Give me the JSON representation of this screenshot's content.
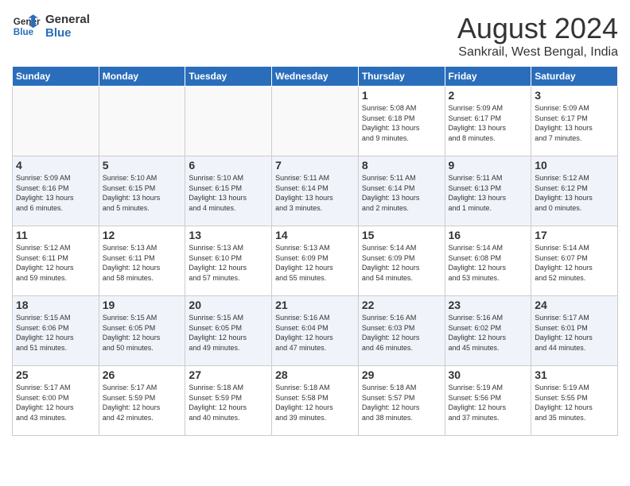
{
  "logo": {
    "line1": "General",
    "line2": "Blue"
  },
  "title": "August 2024",
  "location": "Sankrail, West Bengal, India",
  "days_of_week": [
    "Sunday",
    "Monday",
    "Tuesday",
    "Wednesday",
    "Thursday",
    "Friday",
    "Saturday"
  ],
  "weeks": [
    [
      {
        "day": "",
        "info": ""
      },
      {
        "day": "",
        "info": ""
      },
      {
        "day": "",
        "info": ""
      },
      {
        "day": "",
        "info": ""
      },
      {
        "day": "1",
        "info": "Sunrise: 5:08 AM\nSunset: 6:18 PM\nDaylight: 13 hours\nand 9 minutes."
      },
      {
        "day": "2",
        "info": "Sunrise: 5:09 AM\nSunset: 6:17 PM\nDaylight: 13 hours\nand 8 minutes."
      },
      {
        "day": "3",
        "info": "Sunrise: 5:09 AM\nSunset: 6:17 PM\nDaylight: 13 hours\nand 7 minutes."
      }
    ],
    [
      {
        "day": "4",
        "info": "Sunrise: 5:09 AM\nSunset: 6:16 PM\nDaylight: 13 hours\nand 6 minutes."
      },
      {
        "day": "5",
        "info": "Sunrise: 5:10 AM\nSunset: 6:15 PM\nDaylight: 13 hours\nand 5 minutes."
      },
      {
        "day": "6",
        "info": "Sunrise: 5:10 AM\nSunset: 6:15 PM\nDaylight: 13 hours\nand 4 minutes."
      },
      {
        "day": "7",
        "info": "Sunrise: 5:11 AM\nSunset: 6:14 PM\nDaylight: 13 hours\nand 3 minutes."
      },
      {
        "day": "8",
        "info": "Sunrise: 5:11 AM\nSunset: 6:14 PM\nDaylight: 13 hours\nand 2 minutes."
      },
      {
        "day": "9",
        "info": "Sunrise: 5:11 AM\nSunset: 6:13 PM\nDaylight: 13 hours\nand 1 minute."
      },
      {
        "day": "10",
        "info": "Sunrise: 5:12 AM\nSunset: 6:12 PM\nDaylight: 13 hours\nand 0 minutes."
      }
    ],
    [
      {
        "day": "11",
        "info": "Sunrise: 5:12 AM\nSunset: 6:11 PM\nDaylight: 12 hours\nand 59 minutes."
      },
      {
        "day": "12",
        "info": "Sunrise: 5:13 AM\nSunset: 6:11 PM\nDaylight: 12 hours\nand 58 minutes."
      },
      {
        "day": "13",
        "info": "Sunrise: 5:13 AM\nSunset: 6:10 PM\nDaylight: 12 hours\nand 57 minutes."
      },
      {
        "day": "14",
        "info": "Sunrise: 5:13 AM\nSunset: 6:09 PM\nDaylight: 12 hours\nand 55 minutes."
      },
      {
        "day": "15",
        "info": "Sunrise: 5:14 AM\nSunset: 6:09 PM\nDaylight: 12 hours\nand 54 minutes."
      },
      {
        "day": "16",
        "info": "Sunrise: 5:14 AM\nSunset: 6:08 PM\nDaylight: 12 hours\nand 53 minutes."
      },
      {
        "day": "17",
        "info": "Sunrise: 5:14 AM\nSunset: 6:07 PM\nDaylight: 12 hours\nand 52 minutes."
      }
    ],
    [
      {
        "day": "18",
        "info": "Sunrise: 5:15 AM\nSunset: 6:06 PM\nDaylight: 12 hours\nand 51 minutes."
      },
      {
        "day": "19",
        "info": "Sunrise: 5:15 AM\nSunset: 6:05 PM\nDaylight: 12 hours\nand 50 minutes."
      },
      {
        "day": "20",
        "info": "Sunrise: 5:15 AM\nSunset: 6:05 PM\nDaylight: 12 hours\nand 49 minutes."
      },
      {
        "day": "21",
        "info": "Sunrise: 5:16 AM\nSunset: 6:04 PM\nDaylight: 12 hours\nand 47 minutes."
      },
      {
        "day": "22",
        "info": "Sunrise: 5:16 AM\nSunset: 6:03 PM\nDaylight: 12 hours\nand 46 minutes."
      },
      {
        "day": "23",
        "info": "Sunrise: 5:16 AM\nSunset: 6:02 PM\nDaylight: 12 hours\nand 45 minutes."
      },
      {
        "day": "24",
        "info": "Sunrise: 5:17 AM\nSunset: 6:01 PM\nDaylight: 12 hours\nand 44 minutes."
      }
    ],
    [
      {
        "day": "25",
        "info": "Sunrise: 5:17 AM\nSunset: 6:00 PM\nDaylight: 12 hours\nand 43 minutes."
      },
      {
        "day": "26",
        "info": "Sunrise: 5:17 AM\nSunset: 5:59 PM\nDaylight: 12 hours\nand 42 minutes."
      },
      {
        "day": "27",
        "info": "Sunrise: 5:18 AM\nSunset: 5:59 PM\nDaylight: 12 hours\nand 40 minutes."
      },
      {
        "day": "28",
        "info": "Sunrise: 5:18 AM\nSunset: 5:58 PM\nDaylight: 12 hours\nand 39 minutes."
      },
      {
        "day": "29",
        "info": "Sunrise: 5:18 AM\nSunset: 5:57 PM\nDaylight: 12 hours\nand 38 minutes."
      },
      {
        "day": "30",
        "info": "Sunrise: 5:19 AM\nSunset: 5:56 PM\nDaylight: 12 hours\nand 37 minutes."
      },
      {
        "day": "31",
        "info": "Sunrise: 5:19 AM\nSunset: 5:55 PM\nDaylight: 12 hours\nand 35 minutes."
      }
    ]
  ]
}
